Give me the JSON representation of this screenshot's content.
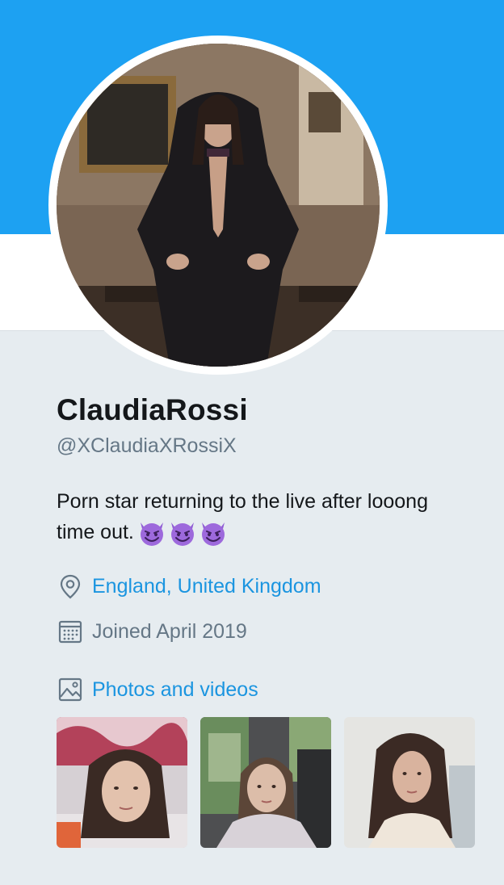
{
  "profile": {
    "display_name": "ClaudiaRossi",
    "handle": "@XClaudiaXRossiX",
    "bio": "Porn star returning to the live after looong time out.",
    "bio_emojis": [
      "smiling-devil-emoji",
      "smiling-devil-emoji",
      "smiling-devil-emoji"
    ],
    "location": "England, United Kingdom",
    "joined": "Joined April 2019",
    "photos_link": "Photos and videos"
  },
  "colors": {
    "banner": "#1da1f2",
    "link": "#1b95e0",
    "secondary_text": "#657786",
    "primary_text": "#14171a",
    "page_background": "#e6ecf0"
  },
  "icons": {
    "location": "map-pin-icon",
    "joined": "calendar-icon",
    "photos": "image-icon"
  },
  "media_thumbnails": [
    {
      "name": "photo-thumbnail-1"
    },
    {
      "name": "photo-thumbnail-2"
    },
    {
      "name": "photo-thumbnail-3"
    }
  ]
}
